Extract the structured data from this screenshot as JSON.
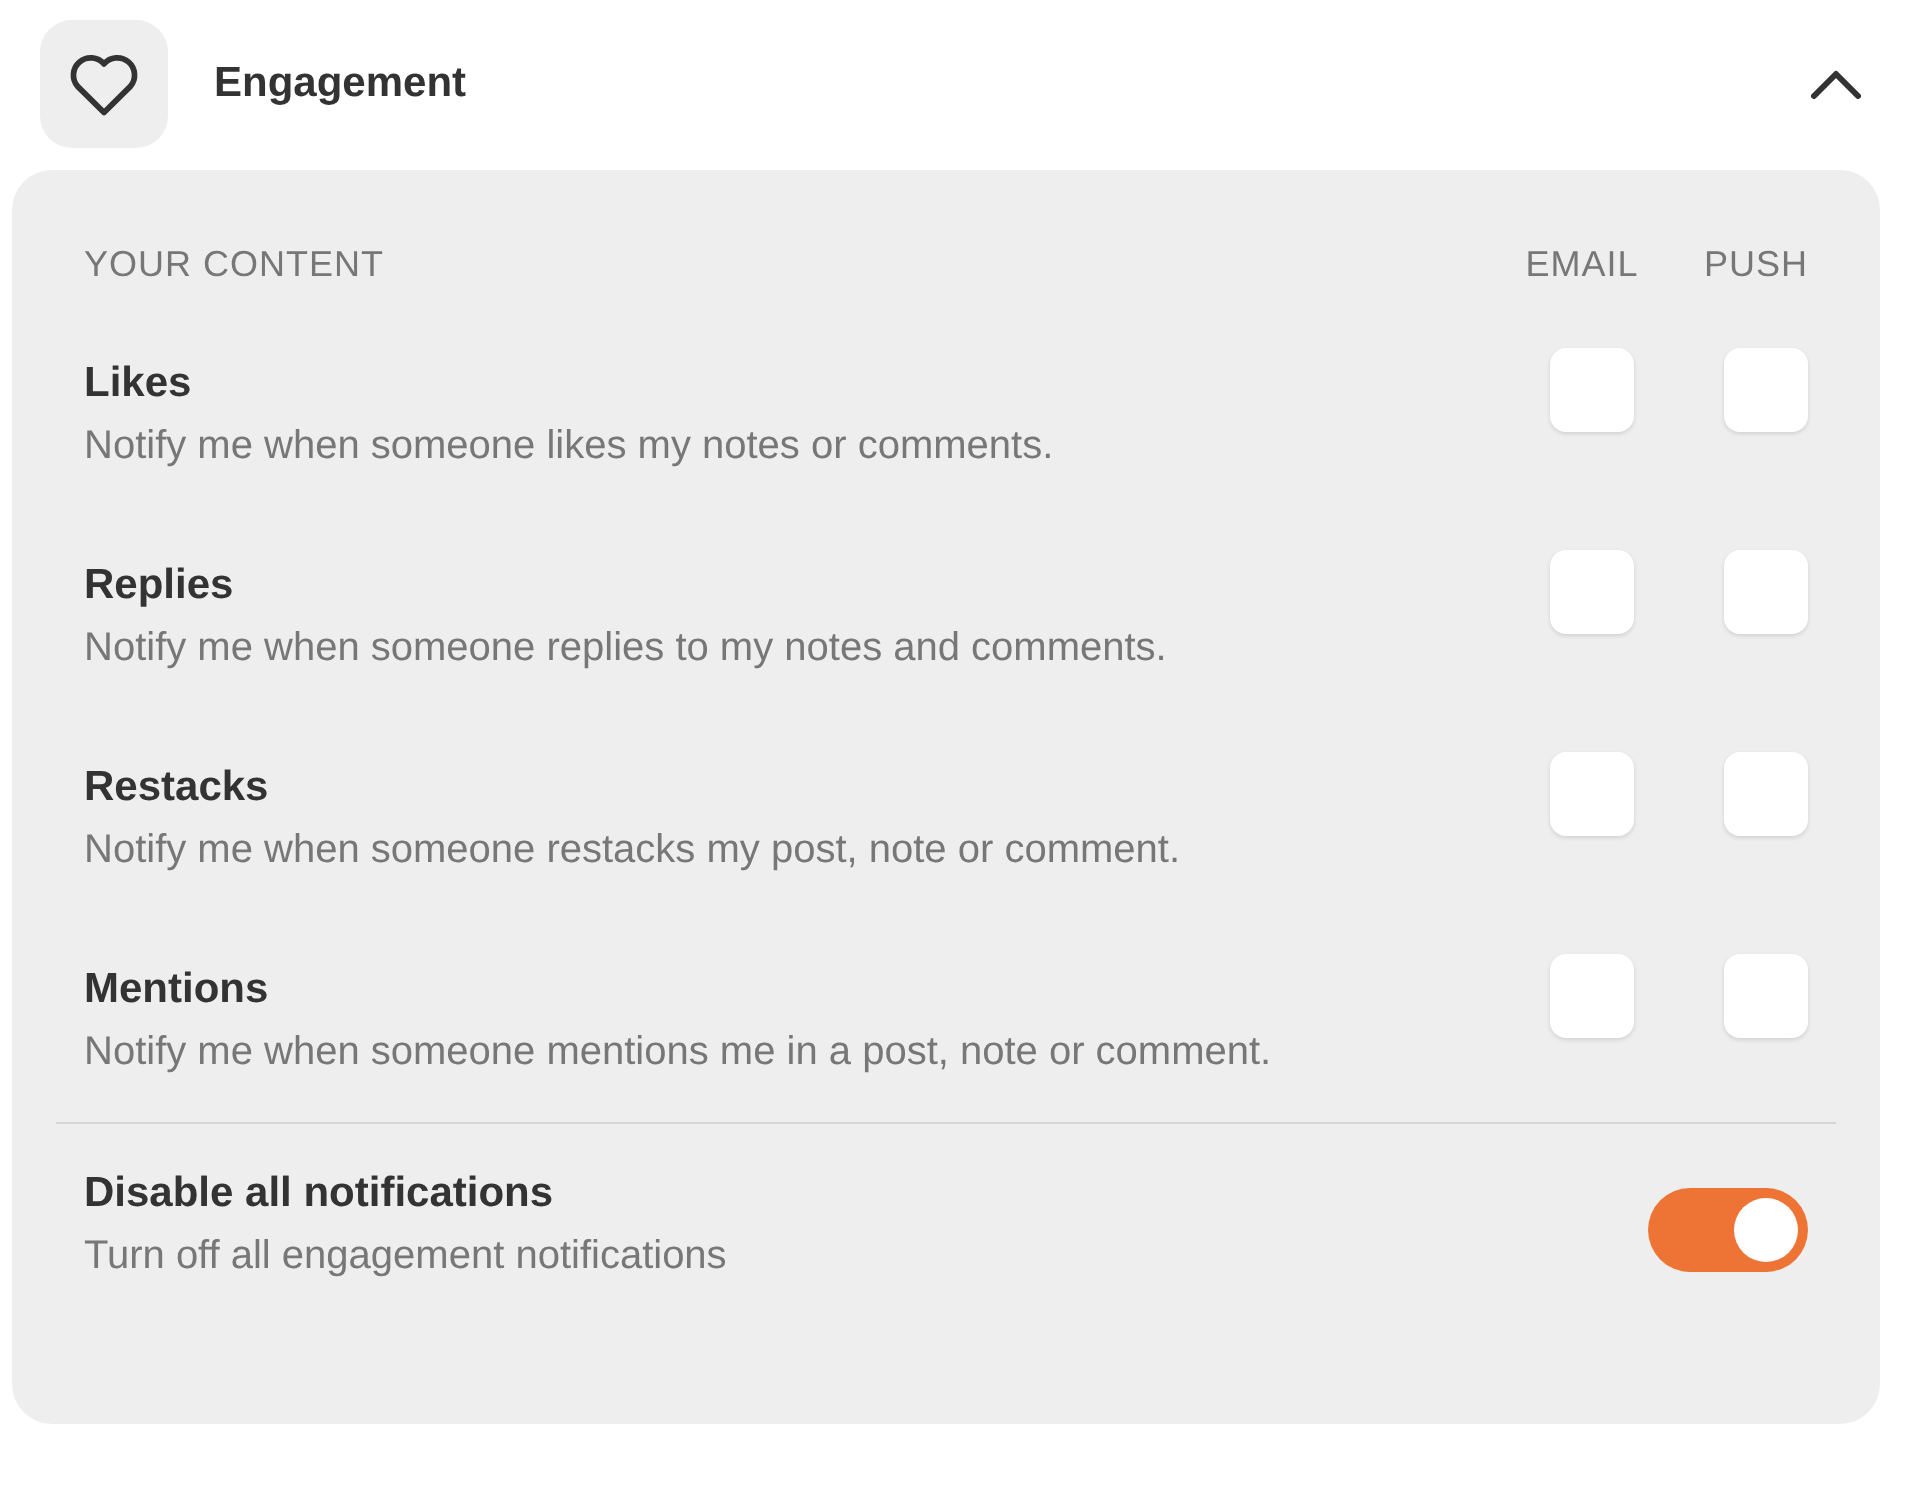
{
  "section": {
    "title": "Engagement",
    "expanded": true
  },
  "columns": {
    "group": "YOUR CONTENT",
    "email": "EMAIL",
    "push": "PUSH"
  },
  "rows": [
    {
      "title": "Likes",
      "description": "Notify me when someone likes my notes or comments.",
      "email": false,
      "push": false
    },
    {
      "title": "Replies",
      "description": "Notify me when someone replies to my notes and comments.",
      "email": false,
      "push": false
    },
    {
      "title": "Restacks",
      "description": "Notify me when someone restacks my post, note or comment.",
      "email": false,
      "push": false
    },
    {
      "title": "Mentions",
      "description": "Notify me when someone mentions me in a post, note or comment.",
      "email": false,
      "push": false
    }
  ],
  "disable_all": {
    "title": "Disable all notifications",
    "description": "Turn off all engagement notifications",
    "on": true
  }
}
